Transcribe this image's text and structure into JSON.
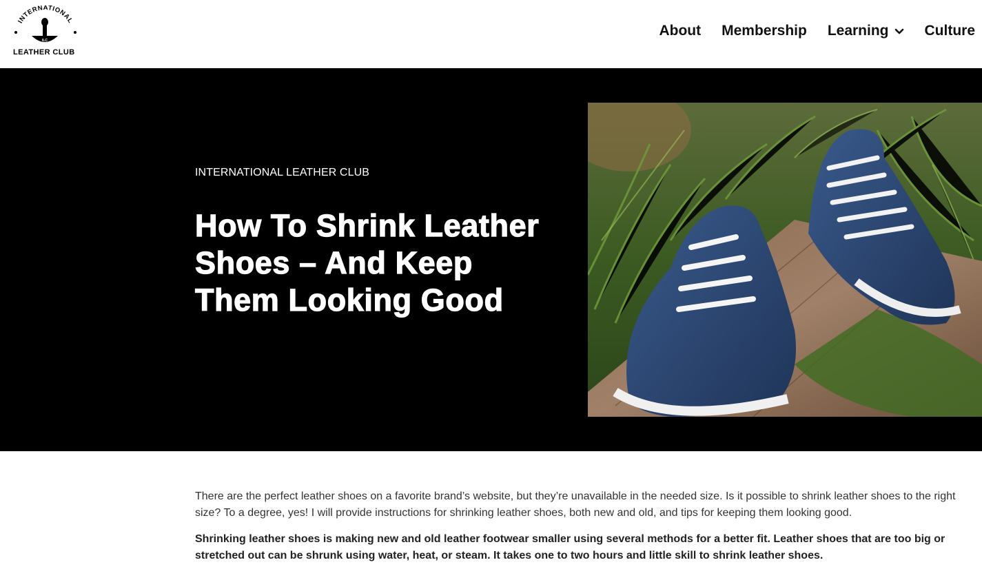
{
  "header": {
    "logo": {
      "arc_text": "INTERNATIONAL",
      "center_text": "ILC",
      "bottom_text": "LEATHER CLUB"
    },
    "nav": [
      {
        "label": "About"
      },
      {
        "label": "Membership"
      },
      {
        "label": "Learning",
        "has_dropdown": true,
        "icon": "chevron-down-icon"
      },
      {
        "label": "Culture"
      }
    ]
  },
  "hero": {
    "eyebrow": "INTERNATIONAL LEATHER CLUB",
    "title": "How To Shrink Leather Shoes – And Keep Them Looking Good",
    "image_subject": "blue leather sneakers with white laces on wooden plank in grass"
  },
  "article": {
    "intro": "There are the perfect leather shoes on a favorite brand’s website, but they’re unavailable in the needed size. Is it possible to shrink leather shoes to the right size? To a degree, yes! I will provide instructions for shrinking leather shoes, both new and old, and tips for keeping them looking good.",
    "summary": "Shrinking leather shoes is making new and old leather footwear smaller using several methods for a better fit. Leather shoes that are too big or stretched out can be shrunk using water, heat, or steam. It takes one to two hours and little skill to shrink leather shoes."
  },
  "colors": {
    "hero_background": "#000000",
    "page_background": "#ffffff",
    "nav_text": "#111111",
    "shoe_blue": "#2a4674"
  }
}
